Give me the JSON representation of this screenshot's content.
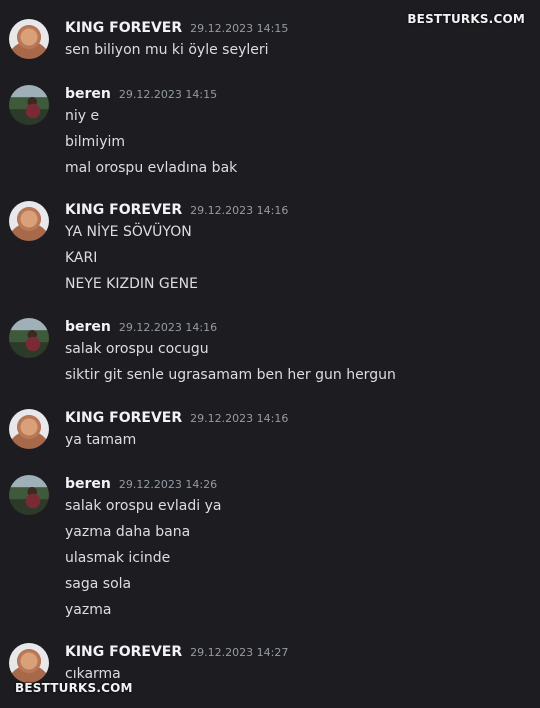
{
  "watermark": "BESTTURKS.COM",
  "groups": [
    {
      "user": "KING FOREVER",
      "time": "29.12.2023 14:15",
      "avatar": "bald-man-avatar",
      "messages": [
        "sen biliyon mu ki öyle seyleri"
      ]
    },
    {
      "user": "beren",
      "time": "29.12.2023 14:15",
      "avatar": "woman-outdoor-avatar",
      "messages": [
        "niy e",
        "bilmiyim",
        "mal orospu evladına bak"
      ]
    },
    {
      "user": "KING FOREVER",
      "time": "29.12.2023 14:16",
      "avatar": "bald-man-avatar",
      "messages": [
        "YA NİYE SÖVÜYON",
        "KARI",
        "NEYE KIZDIN GENE"
      ]
    },
    {
      "user": "beren",
      "time": "29.12.2023 14:16",
      "avatar": "woman-outdoor-avatar",
      "messages": [
        "salak orospu cocugu",
        "siktir git senle ugrasamam ben her gun hergun"
      ]
    },
    {
      "user": "KING FOREVER",
      "time": "29.12.2023 14:16",
      "avatar": "bald-man-avatar",
      "messages": [
        "ya tamam"
      ]
    },
    {
      "user": "beren",
      "time": "29.12.2023 14:26",
      "avatar": "woman-outdoor-avatar",
      "messages": [
        "salak orospu evladi ya",
        "yazma daha bana",
        "ulasmak icinde",
        "saga sola",
        "yazma"
      ]
    },
    {
      "user": "KING FOREVER",
      "time": "29.12.2023 14:27",
      "avatar": "bald-man-avatar",
      "messages": [
        "cıkarma"
      ]
    }
  ]
}
